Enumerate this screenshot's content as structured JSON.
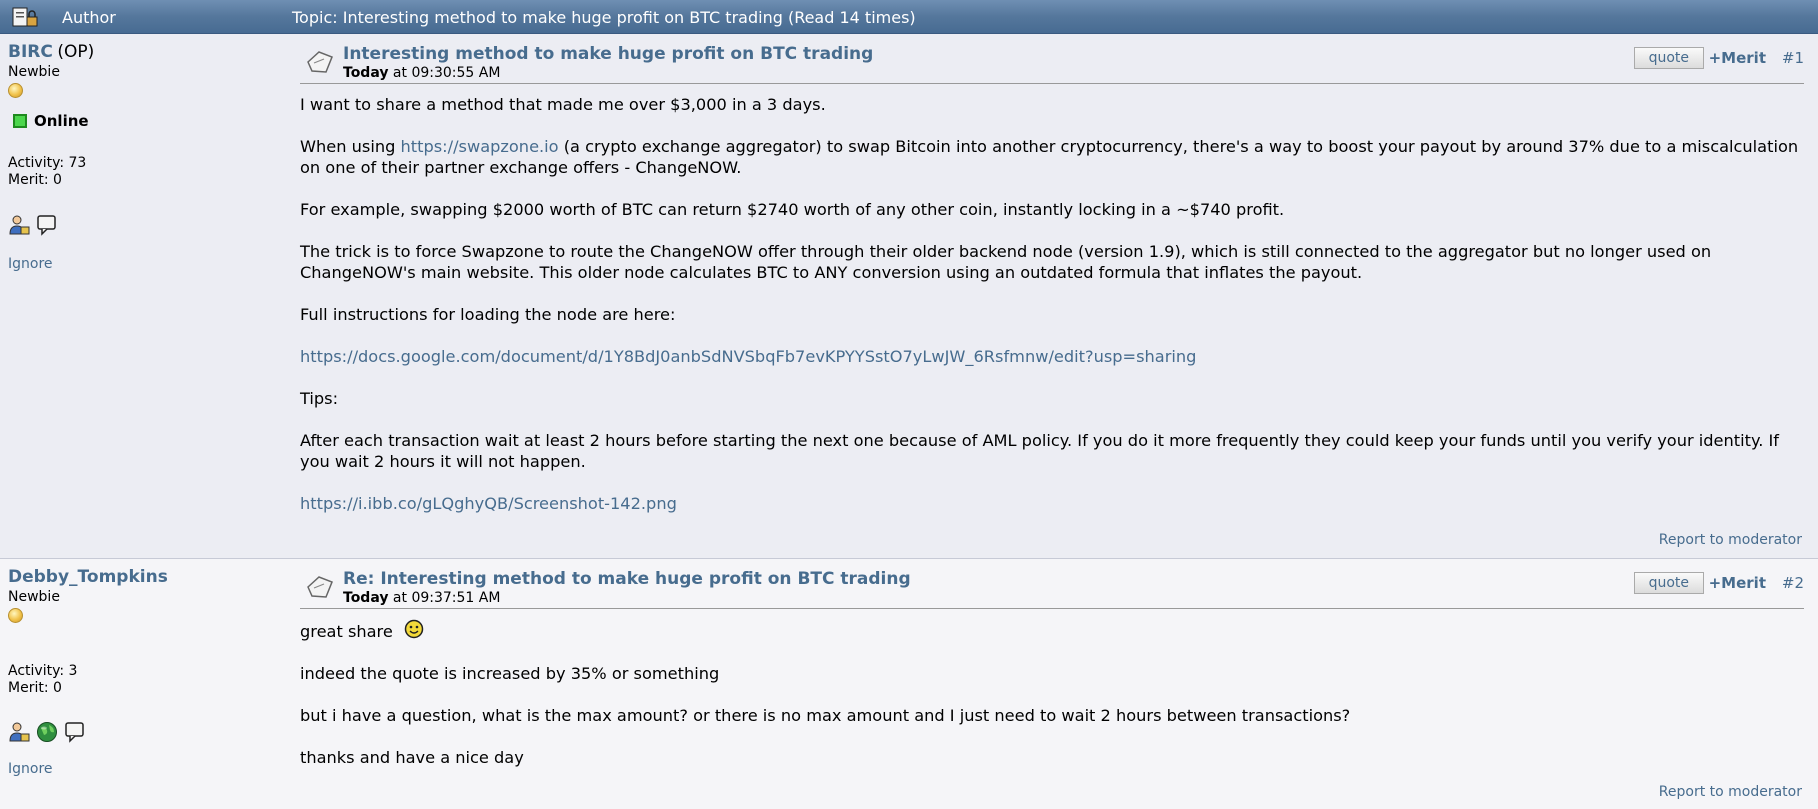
{
  "header": {
    "author_label": "Author",
    "topic_title": "Topic: Interesting method to make huge profit on BTC trading  (Read 14 times)"
  },
  "colors": {
    "link": "#476c8e",
    "header_bg": "#55779c",
    "online": "#4cd64c"
  },
  "posts": [
    {
      "username": "BIRC",
      "op_tag": "(OP)",
      "rank": "Newbie",
      "online_label": "Online",
      "activity": "Activity: 73",
      "merit": "Merit: 0",
      "icons": [
        "profile-icon",
        "message-icon"
      ],
      "ignore_label": "Ignore",
      "subject": "Interesting method to make huge profit on BTC trading",
      "date_day": "Today",
      "date_time": " at 09:30:55 AM",
      "quote_label": "quote",
      "merit_label": "+Merit",
      "number": "#1",
      "body": {
        "line1": "I want to share a method that made me over $3,000 in a 3 days.",
        "p2_pre": "When using ",
        "p2_link": "https://swapzone.io",
        "p2_post": " (a crypto exchange aggregator) to swap Bitcoin into another cryptocurrency, there's a way to boost your payout by around 37% due to a miscalculation on one of their partner exchange offers - ChangeNOW.",
        "p3": "For example, swapping $2000 worth of BTC can return $2740 worth of any other coin, instantly locking in a ~$740 profit.",
        "p4": "The trick is to force Swapzone to route the ChangeNOW offer through their older backend node (version 1.9), which is still connected to the aggregator but no longer used on ChangeNOW's main website. This older node calculates BTC to ANY conversion using an outdated formula that inflates the payout.",
        "p5": "Full instructions for loading the node are here:",
        "p6_link": "https://docs.google.com/document/d/1Y8BdJ0anbSdNVSbqFb7evKPYYSstO7yLwJW_6Rsfmnw/edit?usp=sharing",
        "p7": "Tips:",
        "p8": "After each transaction wait at least 2 hours before starting the next one because of AML policy. If you do it more frequently they could keep your funds until you verify your identity. If you wait 2 hours it will not happen.",
        "p9_link": "https://i.ibb.co/gLQghyQB/Screenshot-142.png"
      },
      "report_label": "Report to moderator"
    },
    {
      "username": "Debby_Tompkins",
      "rank": "Newbie",
      "activity": "Activity: 3",
      "merit": "Merit: 0",
      "icons": [
        "profile-icon",
        "website-globe-icon",
        "message-icon"
      ],
      "ignore_label": "Ignore",
      "subject": "Re: Interesting method to make huge profit on BTC trading",
      "date_day": "Today",
      "date_time": " at 09:37:51 AM",
      "quote_label": "quote",
      "merit_label": "+Merit",
      "number": "#2",
      "body": {
        "p1": "great share ",
        "p2": "indeed the quote is increased by 35% or something",
        "p3": "but i have a question, what is the max amount? or there is no max amount and I just need to wait 2 hours between transactions?",
        "p4": "thanks and have a nice day"
      },
      "report_label": "Report to moderator"
    }
  ]
}
